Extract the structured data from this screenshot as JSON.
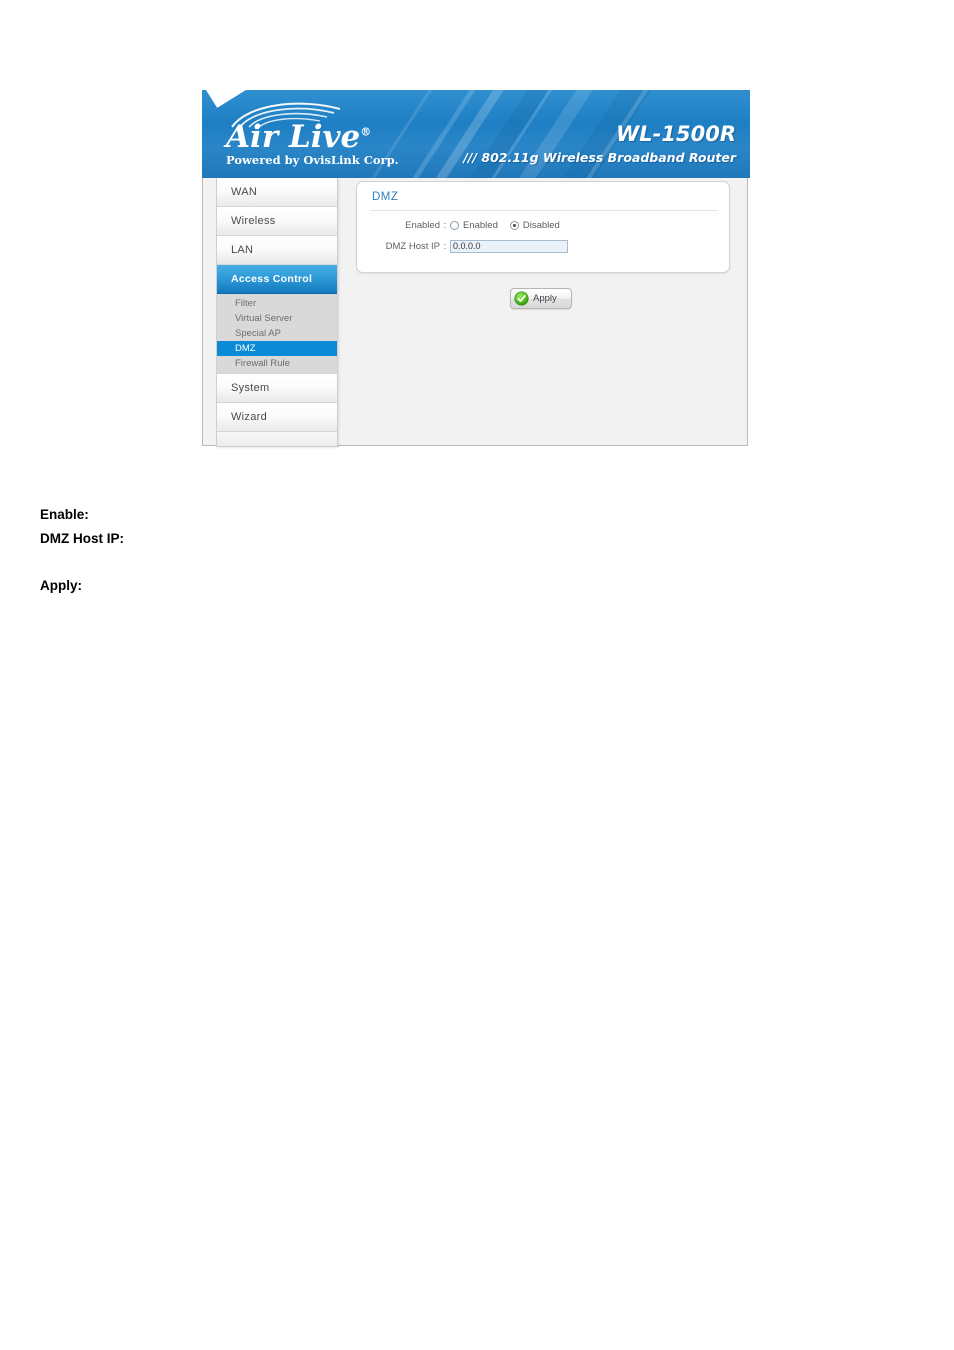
{
  "figure": {
    "banner": {
      "brand_name": "Air Live",
      "brand_reg": "®",
      "brand_tagline": "Powered by OvisLink Corp.",
      "model": "WL-1500R",
      "model_subtitle": "/// 802.11g Wireless Broadband Router",
      "brand_color": "#1e7fc4"
    },
    "sidebar": {
      "items": [
        {
          "label": "WAN",
          "active": false
        },
        {
          "label": "Wireless",
          "active": false
        },
        {
          "label": "LAN",
          "active": false
        },
        {
          "label": "Access Control",
          "active": true
        },
        {
          "label": "System",
          "active": false
        },
        {
          "label": "Wizard",
          "active": false
        }
      ],
      "submenu": [
        {
          "label": "Filter",
          "active": false
        },
        {
          "label": "Virtual Server",
          "active": false
        },
        {
          "label": "Special AP",
          "active": false
        },
        {
          "label": "DMZ",
          "active": true
        },
        {
          "label": "Firewall Rule",
          "active": false
        }
      ],
      "active_color": "#0b8ad6"
    },
    "panel": {
      "title": "DMZ",
      "title_color": "#2f7fc0",
      "enabled_label": "Enabled",
      "enabled_colon": ":",
      "radio_enabled_label": "Enabled",
      "radio_disabled_label": "Disabled",
      "selected_option": "Disabled",
      "host_ip_label": "DMZ Host IP",
      "host_ip_colon": ":",
      "host_ip_value": "0.0.0.0",
      "host_ip_placeholder": "0.0.0.0"
    },
    "apply_button": {
      "label": "Apply",
      "icon": "green-check-icon",
      "icon_color": "#55c421"
    }
  },
  "document": {
    "labels": [
      "Enable:",
      "DMZ Host IP:",
      "Apply:"
    ]
  }
}
